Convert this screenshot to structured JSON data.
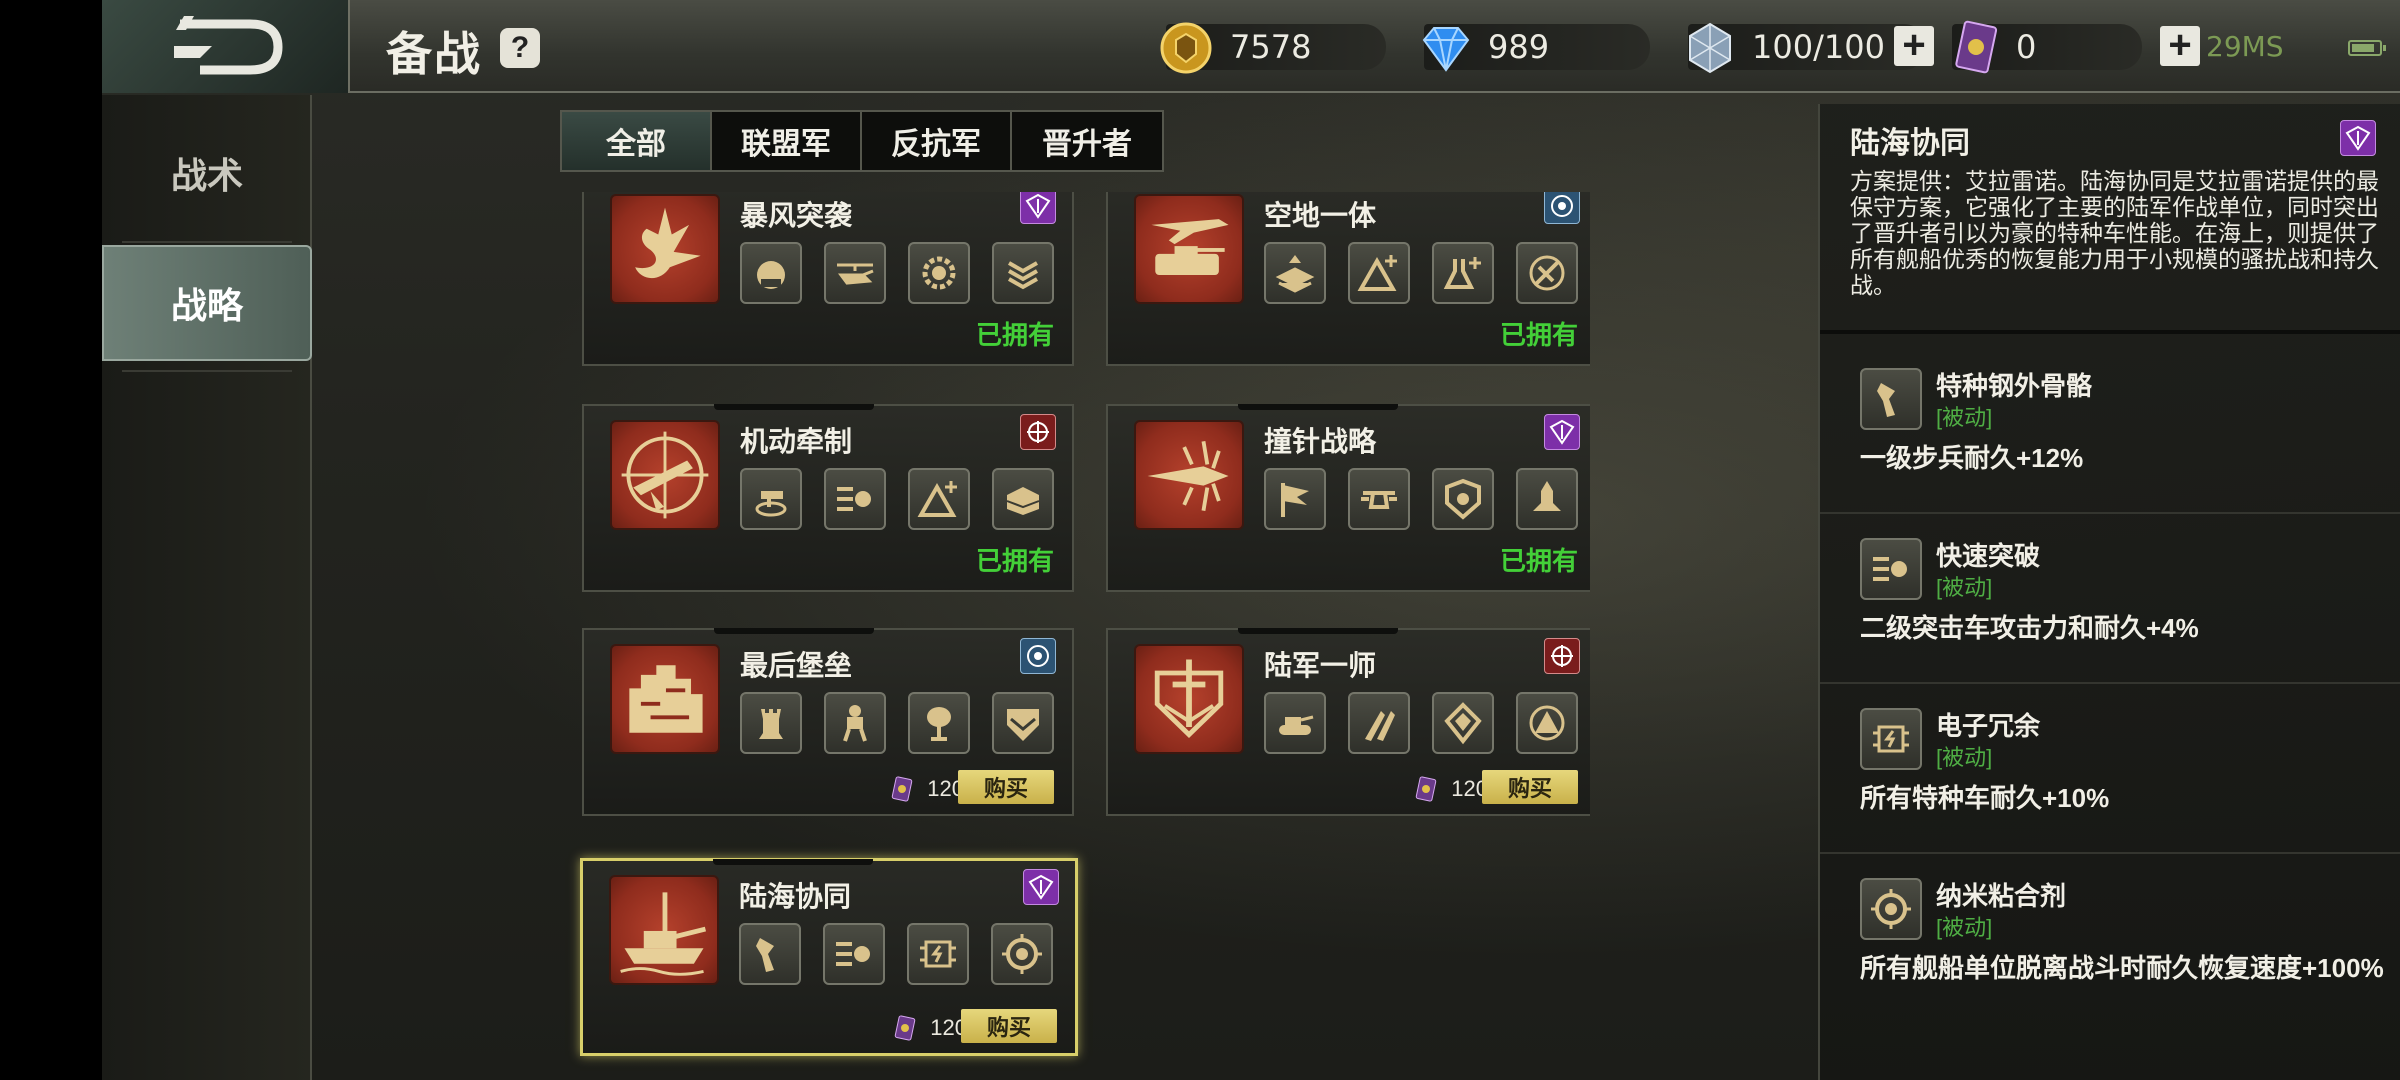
{
  "header": {
    "title": "备战",
    "help_symbol": "?",
    "gold": "7578",
    "diamond": "989",
    "energy": "100/100",
    "tickets": "0",
    "ping": "29MS"
  },
  "nav": {
    "items": [
      {
        "label": "战术",
        "active": false
      },
      {
        "label": "战略",
        "active": true
      }
    ]
  },
  "tabs": [
    "全部",
    "联盟军",
    "反抗军",
    "晋升者"
  ],
  "cards": [
    {
      "title": "暴风突袭",
      "badge": "purple",
      "status": "已拥有",
      "skills": [
        "tank-blast-icon",
        "helicopter-icon",
        "gear-icon",
        "chevron-rank-icon"
      ]
    },
    {
      "title": "空地一体",
      "badge": "blue",
      "status": "已拥有",
      "skills": [
        "layers-up-icon",
        "triangle-plus-icon",
        "lab-plus-icon",
        "propeller-icon"
      ]
    },
    {
      "title": "机动牵制",
      "badge": "red",
      "status": "已拥有",
      "skills": [
        "turret-icon",
        "boost-icon",
        "triangle-plus-icon",
        "armor-plate-icon"
      ]
    },
    {
      "title": "撞针战略",
      "badge": "purple",
      "status": "已拥有",
      "skills": [
        "flag-icon",
        "drone-icon",
        "shield-gear-icon",
        "missile-icon"
      ]
    },
    {
      "title": "最后堡垒",
      "badge": "blue",
      "price": "120",
      "buy": "购买",
      "skills": [
        "tower-icon",
        "mech-icon",
        "tree-icon",
        "shield-stripe-icon"
      ]
    },
    {
      "title": "陆军一师",
      "badge": "red",
      "price": "120",
      "buy": "购买",
      "skills": [
        "tank-icon",
        "missile-pair-icon",
        "diamond-shield-icon",
        "warning-circle-icon"
      ]
    },
    {
      "title": "陆海协同",
      "badge": "purple",
      "price": "120",
      "buy": "购买",
      "selected": true,
      "skills": [
        "arm-icon",
        "boost-icon",
        "chip-icon",
        "nano-icon"
      ]
    }
  ],
  "detail": {
    "title": "陆海协同",
    "description": "方案提供：艾拉雷诺。陆海协同是艾拉雷诺提供的最保守方案，它强化了主要的陆军作战单位，同时突出了晋升者引以为豪的特种车性能。在海上，则提供了所有舰船优秀的恢复能力用于小规模的骚扰战和持久战。",
    "traits": [
      {
        "name": "特种钢外骨骼",
        "tag": "[被动]",
        "effect": "一级步兵耐久+12%"
      },
      {
        "name": "快速突破",
        "tag": "[被动]",
        "effect": "二级突击车攻击力和耐久+4%"
      },
      {
        "name": "电子冗余",
        "tag": "[被动]",
        "effect": "所有特种车耐久+10%"
      },
      {
        "name": "纳米粘合剂",
        "tag": "[被动]",
        "effect": "所有舰船单位脱离战斗时耐久恢复速度+100%"
      }
    ]
  },
  "colors": {
    "owned_green": "#43d038",
    "buy_gold": "#e6d77c",
    "card_red": "#b5412c",
    "passive_green": "#4fae44",
    "selected_border": "#d8cf6a"
  }
}
